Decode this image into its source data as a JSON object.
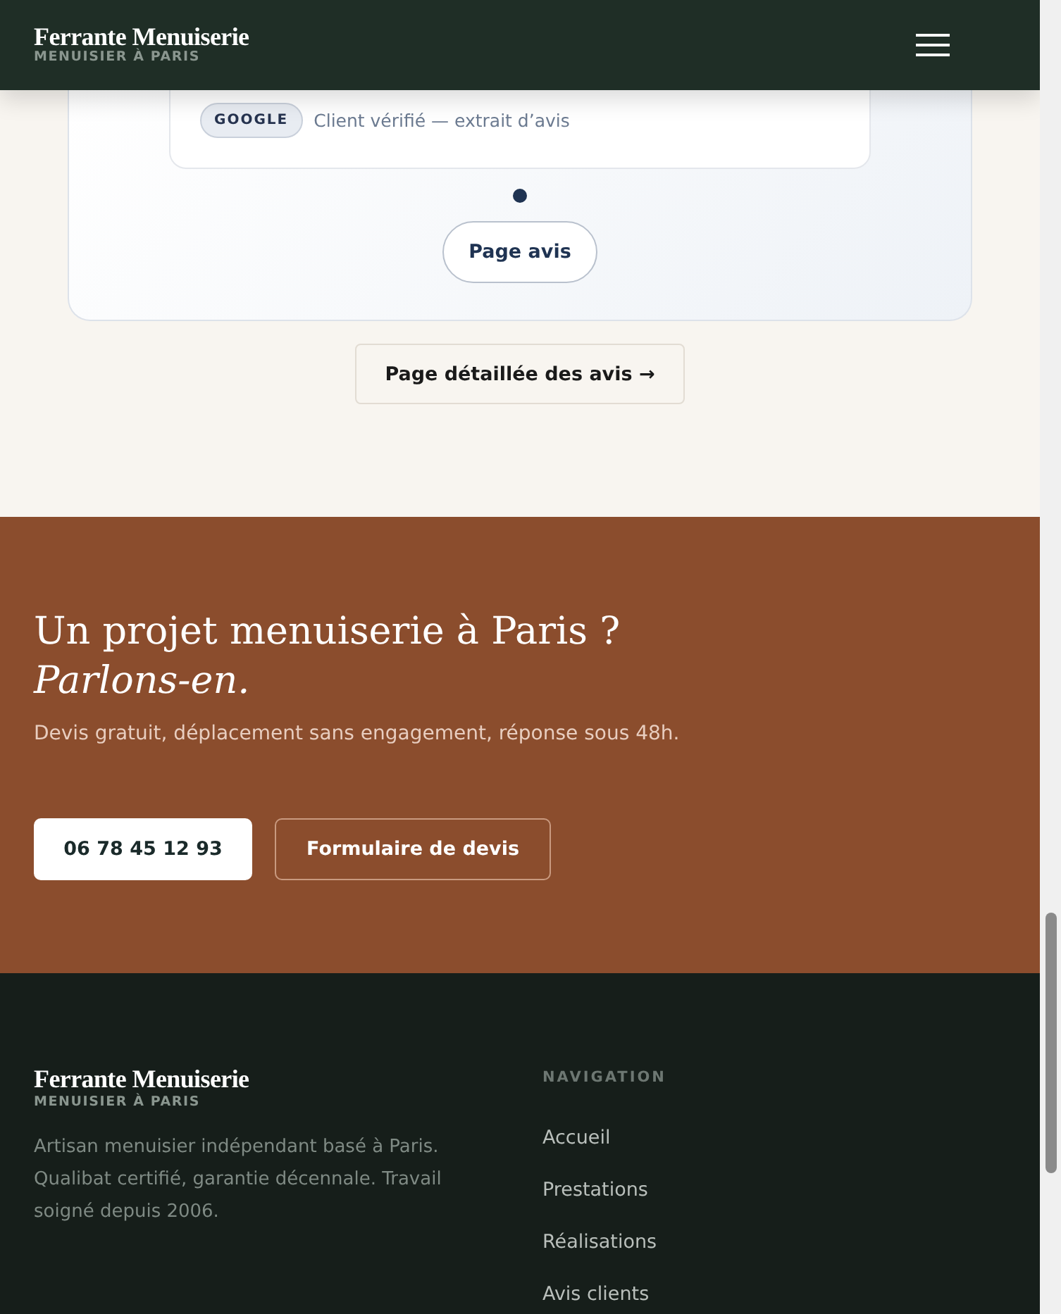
{
  "header": {
    "brand": "Ferrante Menuiserie",
    "tagline": "MENUISIER À PARIS"
  },
  "reviews": {
    "source_tag": "GOOGLE",
    "source_note": "Client vérifié — extrait d’avis",
    "dots": [
      {
        "selected": true
      }
    ],
    "card_button": "Page avis",
    "detail_link": "Page détaillée des avis →"
  },
  "cta": {
    "title": "Un projet menuiserie à Paris ?",
    "title_accent": "Parlons-en.",
    "subtitle": "Devis gratuit, déplacement sans engagement, réponse sous 48h.",
    "buttons": [
      {
        "label": "06 78 45 12 93",
        "kind": "primary"
      },
      {
        "label": "Formulaire de devis",
        "kind": "outline"
      }
    ]
  },
  "footer": {
    "brand": "Ferrante Menuiserie",
    "tagline": "MENUISIER À PARIS",
    "about": "Artisan menuisier indépendant basé à Paris. Qualibat certifié, garantie décennale. Travail soigné depuis 2006.",
    "nav_heading": "NAVIGATION",
    "nav_links": [
      "Accueil",
      "Prestations",
      "Réalisations",
      "Avis clients"
    ]
  }
}
